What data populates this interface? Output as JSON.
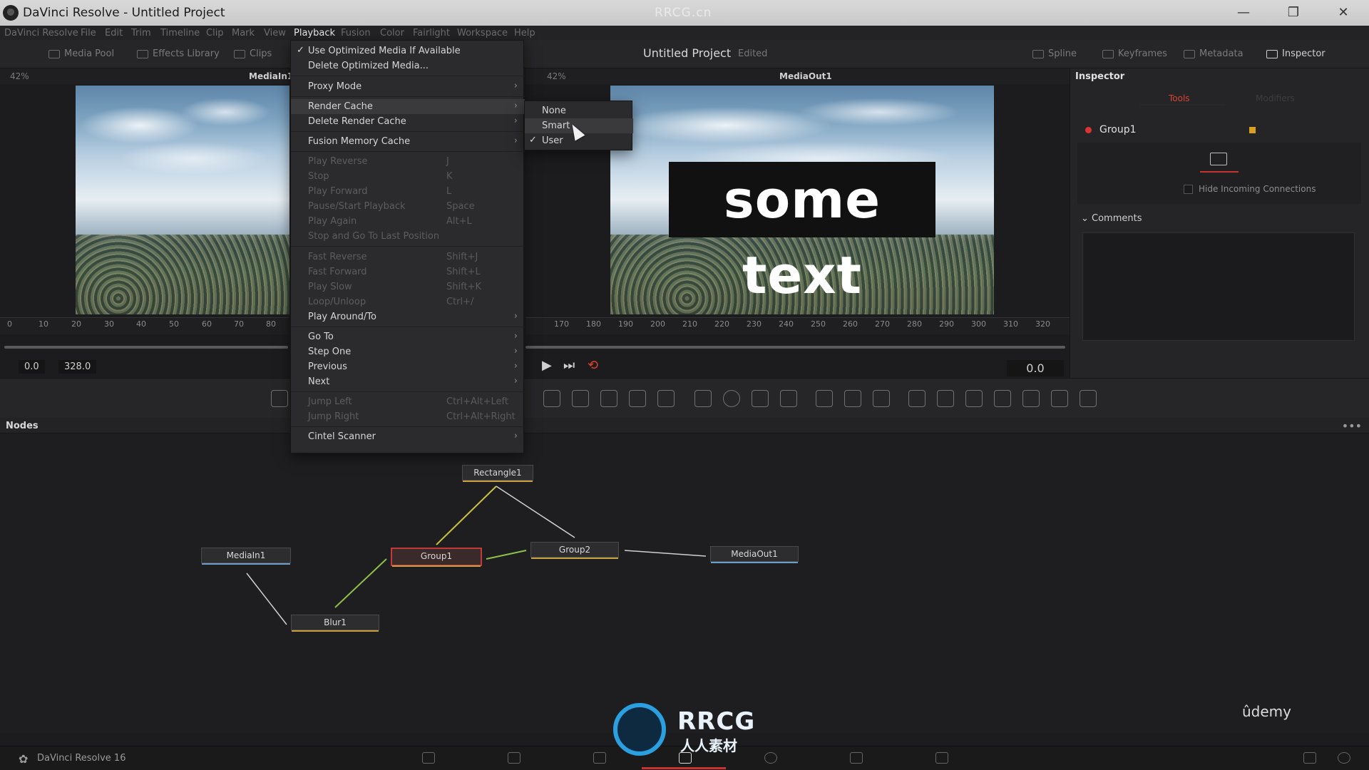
{
  "window": {
    "title": "DaVinci Resolve - Untitled Project",
    "watermark": "RRCG.cn",
    "controls": [
      "—",
      "❐",
      "✕"
    ]
  },
  "menubar": {
    "items": [
      "DaVinci Resolve",
      "File",
      "Edit",
      "Trim",
      "Timeline",
      "Clip",
      "Mark",
      "View",
      "Playback",
      "Fusion",
      "Color",
      "Fairlight",
      "Workspace",
      "Help"
    ],
    "active": "Playback"
  },
  "toolbar": {
    "media_pool": "Media Pool",
    "effects_library": "Effects Library",
    "clips": "Clips",
    "project_title": "Untitled Project",
    "project_status": "Edited",
    "spline": "Spline",
    "keyframes": "Keyframes",
    "metadata": "Metadata",
    "inspector": "Inspector"
  },
  "viewers": {
    "left": {
      "zoom": "42%",
      "name": "MediaIn1"
    },
    "right": {
      "zoom": "42%",
      "name": "MediaOut1"
    },
    "overlay_text": "some text"
  },
  "ruler": {
    "left_ticks": [
      "0",
      "10",
      "20",
      "30",
      "40",
      "50",
      "60",
      "70",
      "80"
    ],
    "right_ticks": [
      "170",
      "180",
      "190",
      "200",
      "210",
      "220",
      "230",
      "240",
      "250",
      "260",
      "270",
      "280",
      "290",
      "300",
      "310",
      "320"
    ]
  },
  "timecodes": {
    "start": "0.0",
    "end": "328.0",
    "current": "0.0"
  },
  "transport": {
    "play": "▶",
    "end": "⏭",
    "loop": "⟲"
  },
  "inspector": {
    "title": "Inspector",
    "tabs": [
      "Tools",
      "Modifiers"
    ],
    "active_tab": "Tools",
    "node_name": "Group1",
    "node_dot_color": "#dd3333",
    "node_swatch_color": "#d9a020",
    "hide_incoming": "Hide Incoming Connections",
    "comments": "Comments"
  },
  "nodes_panel": {
    "title": "Nodes",
    "nodes": [
      {
        "name": "Rectangle1"
      },
      {
        "name": "MediaIn1"
      },
      {
        "name": "Group1"
      },
      {
        "name": "Group2"
      },
      {
        "name": "MediaOut1"
      },
      {
        "name": "Blur1"
      }
    ]
  },
  "playback_menu": {
    "items": [
      {
        "label": "Use Optimized Media If Available",
        "checked": true
      },
      {
        "label": "Delete Optimized Media..."
      },
      {
        "label": "Proxy Mode",
        "submenu": true
      },
      {
        "label": "Render Cache",
        "submenu": true,
        "highlighted": true
      },
      {
        "label": "Delete Render Cache",
        "submenu": true
      },
      {
        "label": "Fusion Memory Cache",
        "submenu": true
      },
      {
        "label": "Play Reverse",
        "shortcut": "J",
        "disabled": true
      },
      {
        "label": "Stop",
        "shortcut": "K",
        "disabled": true
      },
      {
        "label": "Play Forward",
        "shortcut": "L",
        "disabled": true
      },
      {
        "label": "Pause/Start Playback",
        "shortcut": "Space",
        "disabled": true
      },
      {
        "label": "Play Again",
        "shortcut": "Alt+L",
        "disabled": true
      },
      {
        "label": "Stop and Go To Last Position",
        "disabled": true
      },
      {
        "label": "Fast Reverse",
        "shortcut": "Shift+J",
        "disabled": true
      },
      {
        "label": "Fast Forward",
        "shortcut": "Shift+L",
        "disabled": true
      },
      {
        "label": "Play Slow",
        "shortcut": "Shift+K",
        "disabled": true
      },
      {
        "label": "Loop/Unloop",
        "shortcut": "Ctrl+/",
        "disabled": true
      },
      {
        "label": "Play Around/To",
        "submenu": true
      },
      {
        "label": "Go To",
        "submenu": true
      },
      {
        "label": "Step One",
        "submenu": true
      },
      {
        "label": "Previous",
        "submenu": true
      },
      {
        "label": "Next",
        "submenu": true
      },
      {
        "label": "Jump Left",
        "shortcut": "Ctrl+Alt+Left",
        "disabled": true
      },
      {
        "label": "Jump Right",
        "shortcut": "Ctrl+Alt+Right",
        "disabled": true
      },
      {
        "label": "Cintel Scanner",
        "submenu": true
      }
    ]
  },
  "render_cache_submenu": {
    "items": [
      {
        "label": "None"
      },
      {
        "label": "Smart",
        "highlighted": true
      },
      {
        "label": "User",
        "checked": true
      }
    ]
  },
  "bottombar": {
    "version": "DaVinci Resolve 16",
    "active_page": "Fusion"
  },
  "branding": {
    "udemy": "ûdemy",
    "rrcg": "RRCG",
    "rrcg_sub": "人人素材"
  },
  "glyphs": {
    "check": "✓",
    "arrow": "›"
  }
}
